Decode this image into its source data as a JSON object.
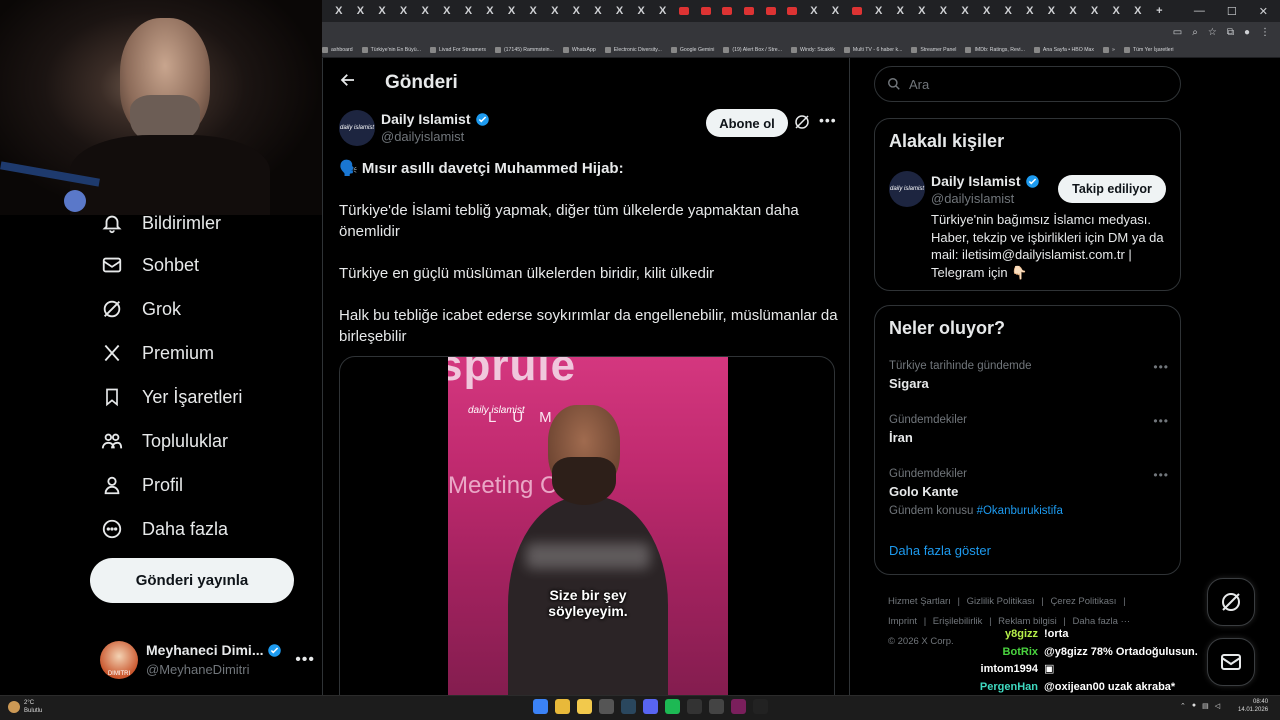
{
  "browser": {
    "tab_close_glyph": "X",
    "tabs_count": 38,
    "new_tab": "+",
    "window_controls": [
      "—",
      "☐",
      "✕"
    ],
    "bookmarks": [
      "ashboard",
      "Türkiye'nin En Büyü...",
      "Livad For Streamers",
      "(17145) Rammstein...",
      "WhatsApp",
      "Electronic Diversity...",
      "Google Gemini",
      "(19) Alert Box / Stre...",
      "Windy: Sicaklik",
      "Multi TV - 6 haber k...",
      "Streamer Panel",
      "IMDb: Ratings, Revi...",
      "Ana Sayfa • HBO Max",
      "»",
      "Tüm Yer İşaretleri"
    ]
  },
  "nav": {
    "items": [
      {
        "label": "Bildirimler",
        "icon": "bell-icon"
      },
      {
        "label": "Sohbet",
        "icon": "mail-icon"
      },
      {
        "label": "Grok",
        "icon": "grok-icon"
      },
      {
        "label": "Premium",
        "icon": "x-logo-icon"
      },
      {
        "label": "Yer İşaretleri",
        "icon": "bookmark-icon"
      },
      {
        "label": "Topluluklar",
        "icon": "people-icon"
      },
      {
        "label": "Profil",
        "icon": "person-icon"
      },
      {
        "label": "Daha fazla",
        "icon": "more-circle-icon"
      }
    ],
    "post_button": "Gönderi yayınla",
    "profile": {
      "name": "Meyhaneci Dimi...",
      "handle": "@MeyhaneDimitri",
      "avatar_text": "DIMITRI"
    }
  },
  "post": {
    "header_title": "Gönderi",
    "author_name": "Daily Islamist",
    "author_handle": "@dailyislamist",
    "avatar_text": "daily islamist",
    "subscribe_label": "Abone ol",
    "lead": "🗣️ Mısır asıllı davetçi Muhammed Hijab:",
    "paragraphs": [
      "Türkiye'de İslami tebliğ yapmak, diğer tüm ülkelerde yapmaktan daha önemlidir",
      "Türkiye en güçlü müslüman ülkelerden biridir, kilit ülkedir",
      "Halk bu tebliğe icabet ederse soykırımlar da engellenebilir, müslümanlar da birleşebilir"
    ],
    "video": {
      "bg_text_1": "sprule",
      "bg_text_2": "LUMA",
      "bg_text_3": "Meeting Civiliz",
      "logo_text": "daily islamist",
      "caption_1": "Size bir şey",
      "caption_2": "söyleyeyim."
    }
  },
  "sidebar": {
    "search_placeholder": "Ara",
    "related_title": "Alakalı kişiler",
    "related": {
      "name": "Daily Islamist",
      "handle": "@dailyislamist",
      "bio": "Türkiye'nin bağımsız İslamcı medyası. Haber, tekzip ve işbirlikleri için DM ya da mail: iletisim@dailyislamist.com.tr | Telegram için 👇🏻",
      "follow_label": "Takip ediliyor",
      "avatar_text": "daily islamist"
    },
    "trends_title": "Neler oluyor?",
    "trends": [
      {
        "context": "Türkiye tarihinde gündemde",
        "title": "Sigara"
      },
      {
        "context": "Gündemdekiler",
        "title": "İran"
      },
      {
        "context": "Gündemdekiler",
        "title": "Golo Kante",
        "topic_label": "Gündem konusu",
        "topic_tag": "#Okanburukistifa"
      }
    ],
    "show_more": "Daha fazla göster",
    "footer": {
      "row1": [
        "Hizmet Şartları",
        "|",
        "Gizlilik Politikası",
        "|",
        "Çerez Politikası",
        "|"
      ],
      "row2": [
        "Imprint",
        "|",
        "Erişilebilirlik",
        "|",
        "Reklam bilgisi",
        "|",
        "Daha fazla ···"
      ],
      "copyright": "© 2026 X Corp."
    }
  },
  "chat": [
    {
      "user": "y8gizz",
      "color": "#b7f04a",
      "message": "!orta"
    },
    {
      "user": "BotRix",
      "color": "#4ad43f",
      "message": "@y8gizz 78% Ortadoğulusun."
    },
    {
      "user": "imtom1994",
      "color": "#ffffff",
      "message": "▣"
    },
    {
      "user": "PergenHan",
      "color": "#3fd9c0",
      "message": "@oxijean00 uzak akraba*"
    }
  ],
  "taskbar": {
    "weather_temp": "2°C",
    "weather_desc": "Bulutlu",
    "time": "08:40",
    "date": "14.01.2026"
  },
  "colors": {
    "accent": "#1d9bf0",
    "background": "#000000",
    "border": "#2f3336",
    "muted": "#71767b"
  }
}
